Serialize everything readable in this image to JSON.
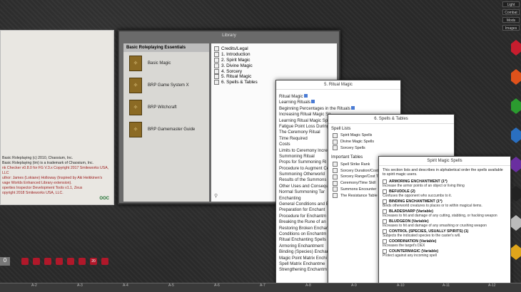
{
  "chat": {
    "lines": [
      {
        "text": "Basic Roleplaying (c) 2010, Chaosium, Inc.",
        "red": false
      },
      {
        "text": "Basic Roleplaying (tm) is a trademark of Chaosium, Inc.",
        "red": false
      },
      {
        "text": "nk Checker v0.8.0 for FG V.3.x Copyright 2017 Smiteworks USA,",
        "red": true
      },
      {
        "text": "LLC",
        "red": true
      },
      {
        "text": "uthor: James (Lokiane) Holloway (Inspired by Aki Heikkinen's",
        "red": true
      },
      {
        "text": "vage Worlds Enhanced Library extension).",
        "red": true
      },
      {
        "text": "operties Inspector Development Tools v1.1, Zeus",
        "red": true
      },
      {
        "text": "opyright 2018 Smiteworks USA, LLC.",
        "red": true
      }
    ],
    "occ_label": "OOC"
  },
  "library": {
    "title": "Library",
    "header": "Basic Roleplaying Essentials",
    "books": [
      "Basic Magic",
      "BRP Game System X",
      "BRP Witchcraft",
      "BRP Gamemaster Guide"
    ],
    "chapters": [
      "Credits/Legal",
      "1. Introduction",
      "2. Spirit Magic",
      "3. Divine Magic",
      "4. Sorcery",
      "5. Ritual Magic",
      "6. Spells & Tables"
    ]
  },
  "ritual": {
    "title": "5. Ritual Magic",
    "items": [
      "Ritual Magic",
      "Learning Rituals",
      "Beginning Percentages in the Rituals",
      "Increasing Ritual Magic Sp",
      "Learning Ritual Magic Sp",
      "Fatigue Point Loss During",
      "The Ceremony Ritual",
      "Time Required",
      "Costs",
      "Limits to Ceremony Increa",
      "Summoning Ritual",
      "Props for Summoning Ri",
      "Procedure to Augment Ce",
      "Summoning Otherworld",
      "Results of the Summons",
      "Other Uses and Conseque",
      "Normal Summoning Tar",
      "Enchanting",
      "General Conditions and E",
      "Preparation for Enchant",
      "Procedure for Enchantm",
      "Breaking the Rune of an",
      "Restoring Broken Enchan",
      "Conditions on Enchantm",
      "Ritual Enchanting Spells",
      "Armoring Enchantment",
      "Binding (Species) Enchar",
      "Magic Point Matrix Enchi",
      "Spell Matrix Enchantme",
      "Strengthening Enchantm"
    ]
  },
  "spells": {
    "title": "6. Spells & Tables",
    "spell_lists_label": "Spell Lists",
    "spell_lists": [
      "Spirit Magic Spells",
      "Divine Magic Spells",
      "Sorcery Spells"
    ],
    "tables_label": "Important Tables",
    "tables": [
      "Spell Strike Rank",
      "Sorcery Duration/Cost",
      "Sorcery Range/Cost Ta",
      "Ceremony/Time Skill",
      "Summons Encounter",
      "The Resistance Table"
    ]
  },
  "smspells": {
    "title": "Spirit Magic Spells",
    "intro": "This section lists and describes in alphabetical order the spells available to spirit magic users.",
    "spells": [
      {
        "name": "ARMORING ENCHANTMENT (1*)",
        "desc": "Increase the armor points of an object or living thing"
      },
      {
        "name": "BEFUDDLE (2)",
        "desc": "Confuses the opponent who succumbs to it."
      },
      {
        "name": "BINDING ENCHANTMENT (1*)",
        "desc": "Binds otherworld creatures to places or to within magical items."
      },
      {
        "name": "BLADESHARP (Variable)",
        "desc": "Increases to hit and damage of any cutting, stabbing, or hacking weapon"
      },
      {
        "name": "BLUDGEON (Variable)",
        "desc": "Increases to hit and damage of any smashing or crushing weapon"
      },
      {
        "name": "CONTROL (SPECIES, USUALLY SPIRITS) (1)",
        "desc": "Subjects the indicated species to the caster's will."
      },
      {
        "name": "COORDINATION (Variable)",
        "desc": "Increases the target's DEX"
      },
      {
        "name": "COUNTERMAGIC (Variable)",
        "desc": "Protect against any incoming spell"
      }
    ]
  },
  "top_buttons": [
    "Light",
    "Combat",
    "Mods",
    "Images"
  ],
  "ruler_ticks": [
    "A-2",
    "A-3",
    "A-4",
    "A-5",
    "A-6",
    "A-7",
    "A-8",
    "A-9",
    "A-10",
    "A-11",
    "A-12"
  ],
  "die_colors": [
    "#c71d2e",
    "#e0521b",
    "#2b9b2f",
    "#2a6fc0",
    "#6a2fa0",
    "#222222",
    "#bbbbbb",
    "#e0a51b"
  ],
  "hotbar_count": "0",
  "hotbar_die_labels": [
    "",
    "",
    "",
    "",
    "",
    "",
    "20",
    ""
  ]
}
